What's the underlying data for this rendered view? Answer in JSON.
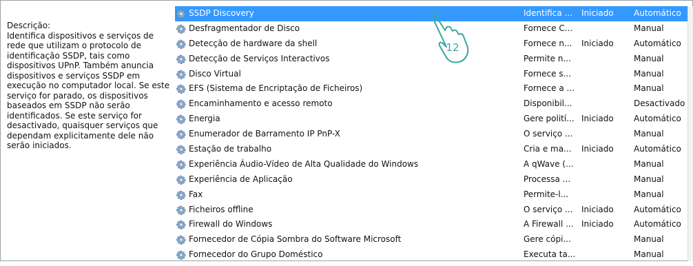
{
  "description": {
    "heading": "Descrição:",
    "body": "Identifica dispositivos e serviços de rede que utilizam o protocolo de identificação SSDP, tais como dispositivos UPnP. Também anuncia dispositivos e serviços SSDP em execução no computador local. Se este serviço for parado, os dispositivos baseados em SSDP não serão identificados. Se este serviço for desactivado, quaisquer serviços que dependam explicitamente dele não serão iniciados."
  },
  "services": [
    {
      "name": "SSDP Discovery",
      "description": "Identifica ...",
      "status": "Iniciado",
      "startup": "Automático"
    },
    {
      "name": "Desfragmentador de Disco",
      "description": "Fornece C...",
      "status": "",
      "startup": "Manual"
    },
    {
      "name": "Detecção de hardware da shell",
      "description": "Fornece n...",
      "status": "Iniciado",
      "startup": "Automático"
    },
    {
      "name": "Detecção de Serviços Interactivos",
      "description": "Permite n...",
      "status": "",
      "startup": "Manual"
    },
    {
      "name": "Disco Virtual",
      "description": "Fornece s...",
      "status": "",
      "startup": "Manual"
    },
    {
      "name": "EFS (Sistema de Encriptação de Ficheiros)",
      "description": "Fornece a ...",
      "status": "",
      "startup": "Manual"
    },
    {
      "name": "Encaminhamento e acesso remoto",
      "description": "Disponibil...",
      "status": "",
      "startup": "Desactivado"
    },
    {
      "name": "Energia",
      "description": "Gere polití...",
      "status": "Iniciado",
      "startup": "Automático"
    },
    {
      "name": "Enumerador de Barramento IP PnP-X",
      "description": "O serviço ...",
      "status": "",
      "startup": "Manual"
    },
    {
      "name": "Estação de trabalho",
      "description": "Cria e ma...",
      "status": "Iniciado",
      "startup": "Automático"
    },
    {
      "name": "Experiência Áudio-Vídeo de Alta Qualidade do Windows",
      "description": "A qWave (...",
      "status": "",
      "startup": "Manual"
    },
    {
      "name": "Experiência de Aplicação",
      "description": "Processa ...",
      "status": "",
      "startup": "Manual"
    },
    {
      "name": "Fax",
      "description": "Permite-l...",
      "status": "",
      "startup": "Manual"
    },
    {
      "name": "Ficheiros offline",
      "description": "O serviço ...",
      "status": "Iniciado",
      "startup": "Automático"
    },
    {
      "name": "Firewall do Windows",
      "description": "A Firewall ...",
      "status": "Iniciado",
      "startup": "Automático"
    },
    {
      "name": "Fornecedor de Cópia Sombra do Software Microsoft",
      "description": "Gere cópi...",
      "status": "",
      "startup": "Manual"
    },
    {
      "name": "Fornecedor do Grupo Doméstico",
      "description": "Executa ta...",
      "status": "",
      "startup": "Manual"
    }
  ],
  "selected_index": 0,
  "callout": {
    "number": "12"
  },
  "colors": {
    "selection": "#3399ff",
    "callout": "#35a89f"
  },
  "icons": {
    "service": "gear-icon",
    "callout": "tap-hand-icon"
  }
}
